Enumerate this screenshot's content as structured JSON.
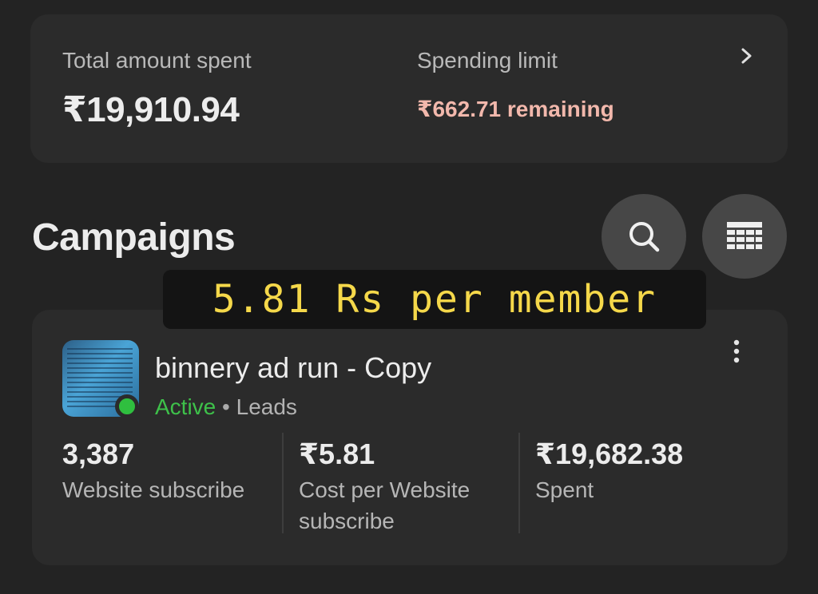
{
  "summary": {
    "total_label": "Total amount spent",
    "total_value": "₹19,910.94",
    "limit_label": "Spending limit",
    "limit_value": "₹662.71 remaining",
    "limit_color": "#f2b8ac"
  },
  "campaigns_section": {
    "title": "Campaigns",
    "search_icon": "search-icon",
    "table_icon": "table-icon"
  },
  "caption": {
    "text": "5.81 Rs per member",
    "color": "#f5d84a"
  },
  "campaign": {
    "name": "binnery ad run - Copy",
    "status": "Active",
    "status_color": "#3ec14a",
    "separator": "•",
    "objective": "Leads",
    "more_icon": "more-vertical-icon",
    "metrics": [
      {
        "value": "3,387",
        "label": "Website subscribe"
      },
      {
        "value": "₹5.81",
        "label": "Cost per Website subscribe"
      },
      {
        "value": "₹19,682.38",
        "label": "Spent"
      }
    ]
  }
}
